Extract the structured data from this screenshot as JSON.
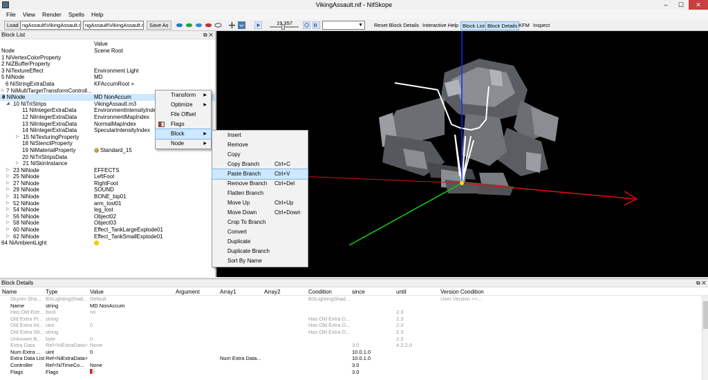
{
  "window": {
    "title": "VikingAssault.nif - NifSkope",
    "min": "–",
    "max": "☐",
    "close": "✕"
  },
  "menu": [
    "File",
    "View",
    "Render",
    "Spells",
    "Help"
  ],
  "toolbar": {
    "load": "Load",
    "path1": "ngAssault\\VikingAssault.nif",
    "path2": "ngAssault\\VikingAssault.nif",
    "save_as": "Save As",
    "time": "19.357",
    "reset_block_details": "Reset Block Details",
    "interactive_help": "Interactive Help",
    "block_list": "Block List",
    "block_details": "Block Details",
    "kfm": "KFM",
    "inspect": "Inspect"
  },
  "block_list": {
    "title": "Block List",
    "header_value": "Value",
    "rows": [
      {
        "name": "Node",
        "value": "Scene Root",
        "indent": 0,
        "exp": ""
      },
      {
        "name": "1 NiVertexColorProperty",
        "value": "",
        "indent": 0,
        "exp": ""
      },
      {
        "name": "2 NiZBufferProperty",
        "value": "",
        "indent": 0,
        "exp": ""
      },
      {
        "name": "3 NiTextureEffect",
        "value": "Environment Light",
        "indent": 0,
        "exp": ""
      },
      {
        "name": "5 NiNode",
        "value": "MD",
        "indent": 0,
        "exp": ""
      },
      {
        "name": "6 NiStringExtraData",
        "value": "KFAccumRoot =",
        "indent": 1,
        "exp": ""
      },
      {
        "name": "7 NiMultiTargetTransformControll...",
        "value": "",
        "indent": 1,
        "exp": "▷"
      },
      {
        "name": "9 NiNode",
        "value": "MD NonAccum",
        "indent": 0,
        "exp": "◢",
        "selected": true
      },
      {
        "name": "10 NiTriStrips",
        "value": "VikingAssault.m3",
        "indent": 2,
        "exp": "◢"
      },
      {
        "name": "11 NiIntegerExtraData",
        "value": "EnvironmentIntensityIndex",
        "indent": 3,
        "exp": ""
      },
      {
        "name": "12 NiIntegerExtraData",
        "value": "EnvironmentMapIndex",
        "indent": 3,
        "exp": ""
      },
      {
        "name": "13 NiIntegerExtraData",
        "value": "NormalMapIndex",
        "indent": 3,
        "exp": ""
      },
      {
        "name": "14 NiIntegerExtraData",
        "value": "SpecularIntensityIndex",
        "indent": 3,
        "exp": ""
      },
      {
        "name": "15 NiTexturingProperty",
        "value": "",
        "indent": 3,
        "exp": "▷"
      },
      {
        "name": "18 NiStencilProperty",
        "value": "",
        "indent": 3,
        "exp": ""
      },
      {
        "name": "19 NiMaterialProperty",
        "value": "Standard_15",
        "indent": 3,
        "exp": "",
        "icon": "palette"
      },
      {
        "name": "20 NiTriStripsData",
        "value": "",
        "indent": 3,
        "exp": ""
      },
      {
        "name": "21 NiSkinInstance",
        "value": "",
        "indent": 3,
        "exp": "▷"
      },
      {
        "name": "23 NiNode",
        "value": "EFFECTS",
        "indent": 2,
        "exp": "▷"
      },
      {
        "name": "25 NiNode",
        "value": "LeftFoot",
        "indent": 2,
        "exp": "▷"
      },
      {
        "name": "27 NiNode",
        "value": "RightFoot",
        "indent": 2,
        "exp": "▷"
      },
      {
        "name": "29 NiNode",
        "value": "SOUND",
        "indent": 2,
        "exp": "▷"
      },
      {
        "name": "31 NiNode",
        "value": "BONE_bip01",
        "indent": 2,
        "exp": "▷"
      },
      {
        "name": "52 NiNode",
        "value": "arm_lost01",
        "indent": 2,
        "exp": "▷"
      },
      {
        "name": "54 NiNode",
        "value": "leg_lost",
        "indent": 2,
        "exp": "▷"
      },
      {
        "name": "56 NiNode",
        "value": "Object02",
        "indent": 2,
        "exp": "▷"
      },
      {
        "name": "58 NiNode",
        "value": "Object03",
        "indent": 2,
        "exp": "▷"
      },
      {
        "name": "60 NiNode",
        "value": "Effect_TankLargeExplode01",
        "indent": 2,
        "exp": "▷"
      },
      {
        "name": "62 NiNode",
        "value": "Effect_TankSmallExplode01",
        "indent": 2,
        "exp": "▷"
      },
      {
        "name": "64 NiAmbientLight",
        "value": "",
        "indent": 0,
        "exp": "",
        "icon": "bulb"
      }
    ]
  },
  "context_menu": [
    {
      "label": "Transform",
      "submenu": true,
      "icon": false
    },
    {
      "label": "Optimize",
      "submenu": true,
      "icon": false
    },
    {
      "label": "File Offset",
      "submenu": false,
      "icon": false
    },
    {
      "label": "Flags",
      "submenu": false,
      "icon": true
    },
    {
      "label": "Block",
      "submenu": true,
      "icon": false,
      "highlight": true
    },
    {
      "label": "Node",
      "submenu": true,
      "icon": false
    }
  ],
  "block_submenu": [
    {
      "label": "Insert",
      "shortcut": ""
    },
    {
      "label": "Remove",
      "shortcut": ""
    },
    {
      "label": "Copy",
      "shortcut": ""
    },
    {
      "label": "Copy Branch",
      "shortcut": "Ctrl+C"
    },
    {
      "label": "Paste Branch",
      "shortcut": "Ctrl+V",
      "highlight": true
    },
    {
      "label": "Remove Branch",
      "shortcut": "Ctrl+Del"
    },
    {
      "label": "Flatten Branch",
      "shortcut": ""
    },
    {
      "label": "Move Up",
      "shortcut": "Ctrl+Up"
    },
    {
      "label": "Move Down",
      "shortcut": "Ctrl+Down"
    },
    {
      "label": "Crop To Branch",
      "shortcut": ""
    },
    {
      "label": "Convert",
      "shortcut": ""
    },
    {
      "label": "Duplicate",
      "shortcut": ""
    },
    {
      "label": "Duplicate Branch",
      "shortcut": ""
    },
    {
      "label": "Sort By Name",
      "shortcut": ""
    }
  ],
  "block_details": {
    "title": "Block Details",
    "columns": [
      "Name",
      "Type",
      "Value",
      "Argument",
      "Array1",
      "Array2",
      "Condition",
      "since",
      "until",
      "Version Condition"
    ],
    "rows": [
      {
        "dim": true,
        "c": [
          "Skyrim Sha...",
          "BSLightingShad...",
          "Default",
          "",
          "",
          "",
          "BSLightingShad...",
          "",
          "",
          "User Version >=..."
        ]
      },
      {
        "dim": false,
        "c": [
          "Name",
          "string",
          "MD NonAccum",
          "",
          "",
          "",
          "",
          "",
          "",
          ""
        ]
      },
      {
        "dim": true,
        "c": [
          "Has Old Extr...",
          "bool",
          "no",
          "",
          "",
          "",
          "",
          "",
          "2.3",
          ""
        ]
      },
      {
        "dim": true,
        "c": [
          "Old Extra Pr...",
          "string",
          "",
          "",
          "",
          "",
          "Has Old Extra D...",
          "",
          "2.3",
          ""
        ]
      },
      {
        "dim": true,
        "c": [
          "Old Extra Int...",
          "uint",
          "0",
          "",
          "",
          "",
          "Has Old Extra D...",
          "",
          "2.3",
          ""
        ]
      },
      {
        "dim": true,
        "c": [
          "Old Extra Str...",
          "string",
          "",
          "",
          "",
          "",
          "Has Old Extra D...",
          "",
          "2.3",
          ""
        ]
      },
      {
        "dim": true,
        "c": [
          "Unknown B...",
          "byte",
          "0",
          "",
          "",
          "",
          "",
          "",
          "2.3",
          ""
        ]
      },
      {
        "dim": true,
        "c": [
          "Extra Data",
          "Ref<NiExtraData>",
          "None",
          "",
          "",
          "",
          "",
          "3.0",
          "4.2.2.0",
          ""
        ]
      },
      {
        "dim": false,
        "c": [
          "Num Extra ...",
          "uint",
          "0",
          "",
          "",
          "",
          "",
          "10.0.1.0",
          "",
          ""
        ]
      },
      {
        "dim": false,
        "c": [
          "Extra Data List",
          "Ref<NiExtraData>",
          "",
          "",
          "Num Extra Data...",
          "",
          "",
          "10.0.1.0",
          "",
          ""
        ]
      },
      {
        "dim": false,
        "c": [
          "Controller",
          "Ref<NiTimeCo...",
          "None",
          "",
          "",
          "",
          "",
          "3.0",
          "",
          ""
        ]
      },
      {
        "dim": false,
        "c": [
          "Flags",
          "Flags",
          "2",
          "",
          "",
          "",
          "",
          "3.0",
          "",
          ""
        ]
      }
    ]
  },
  "colors": {
    "selection": "#cde8ff",
    "axis_x": "#e01010",
    "axis_y": "#10d010",
    "bones": "#ffffff",
    "root_dot": "#ffe000"
  }
}
